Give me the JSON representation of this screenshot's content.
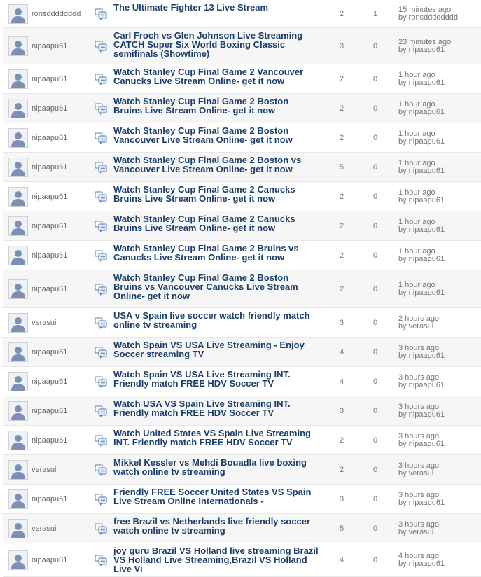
{
  "threads": [
    {
      "author": "ronsdddddddd",
      "title": "The Ultimate Fighter 13 Live Stream",
      "replies": "2",
      "views": "1",
      "last_time": "15 minutes ago",
      "last_by": "by ronsdddddddd"
    },
    {
      "author": "nipaapu61",
      "title": "Carl Froch vs Glen Johnson Live Streaming CATCH Super Six World Boxing Classic semifinals (Showtime)",
      "replies": "3",
      "views": "0",
      "last_time": "23 minutes ago",
      "last_by": "by nipaapu61"
    },
    {
      "author": "nipaapu61",
      "title": "Watch Stanley Cup Final Game 2 Vancouver Canucks Live Stream Online- get it now",
      "replies": "2",
      "views": "0",
      "last_time": "1 hour ago",
      "last_by": "by nipaapu61"
    },
    {
      "author": "nipaapu61",
      "title": "Watch Stanley Cup Final Game 2 Boston Bruins Live Stream Online- get it now",
      "replies": "2",
      "views": "0",
      "last_time": "1 hour ago",
      "last_by": "by nipaapu61"
    },
    {
      "author": "nipaapu61",
      "title": "Watch Stanley Cup Final Game 2 Boston Vancouver Live Stream Online- get it now",
      "replies": "2",
      "views": "0",
      "last_time": "1 hour ago",
      "last_by": "by nipaapu61"
    },
    {
      "author": "nipaapu61",
      "title": "Watch Stanley Cup Final Game 2 Boston vs Vancouver Live Stream Online- get it now",
      "replies": "5",
      "views": "0",
      "last_time": "1 hour ago",
      "last_by": "by nipaapu61"
    },
    {
      "author": "nipaapu61",
      "title": "Watch Stanley Cup Final Game 2 Canucks Bruins Live Stream Online- get it now",
      "replies": "2",
      "views": "0",
      "last_time": "1 hour ago",
      "last_by": "by nipaapu61"
    },
    {
      "author": "nipaapu61",
      "title": "Watch Stanley Cup Final Game 2 Canucks Bruins Live Stream Online- get it now",
      "replies": "2",
      "views": "0",
      "last_time": "1 hour ago",
      "last_by": "by nipaapu61"
    },
    {
      "author": "nipaapu61",
      "title": "Watch Stanley Cup Final Game 2 Bruins vs Canucks Live Stream Online- get it now",
      "replies": "2",
      "views": "0",
      "last_time": "1 hour ago",
      "last_by": "by nipaapu61"
    },
    {
      "author": "nipaapu61",
      "title": "Watch Stanley Cup Final Game 2 Boston Bruins vs Vancouver Canucks Live Stream Online- get it now",
      "replies": "2",
      "views": "0",
      "last_time": "1 hour ago",
      "last_by": "by nipaapu61"
    },
    {
      "author": "verasui",
      "title": "USA v Spain live soccer watch friendly match online tv streaming",
      "replies": "3",
      "views": "0",
      "last_time": "2 hours ago",
      "last_by": "by verasui"
    },
    {
      "author": "nipaapu61",
      "title": "Watch Spain VS USA Live Streaming - Enjoy Soccer streaming TV",
      "replies": "4",
      "views": "0",
      "last_time": "3 hours ago",
      "last_by": "by nipaapu61"
    },
    {
      "author": "nipaapu61",
      "title": "Watch Spain VS USA Live Streaming INT. Friendly match FREE HDV Soccer TV",
      "replies": "4",
      "views": "0",
      "last_time": "3 hours ago",
      "last_by": "by nipaapu61"
    },
    {
      "author": "nipaapu61",
      "title": "Watch USA VS Spain Live Streaming INT. Friendly match FREE HDV Soccer TV",
      "replies": "3",
      "views": "0",
      "last_time": "3 hours ago",
      "last_by": "by nipaapu61"
    },
    {
      "author": "nipaapu61",
      "title": "Watch United States VS Spain Live Streaming INT. Friendly match FREE HDV Soccer TV",
      "replies": "2",
      "views": "0",
      "last_time": "3 hours ago",
      "last_by": "by nipaapu61"
    },
    {
      "author": "verasui",
      "title": "Mikkel Kessler vs Mehdi Bouadla live boxing watch online tv streaming",
      "replies": "2",
      "views": "0",
      "last_time": "3 hours ago",
      "last_by": "by verasui"
    },
    {
      "author": "nipaapu61",
      "title": "Friendly FREE Soccer United States VS Spain Live Stream Online Internationals -",
      "replies": "3",
      "views": "0",
      "last_time": "3 hours ago",
      "last_by": "by nipaapu61"
    },
    {
      "author": "verasui",
      "title": "free Brazil vs Netherlands live friendly soccer watch online tv streaming",
      "replies": "5",
      "views": "0",
      "last_time": "3 hours ago",
      "last_by": "by verasui"
    },
    {
      "author": "nipaapu61",
      "title": "joy guru Brazil VS Holland live streaming Brazil VS Holland Live Streaming,Brazil VS Holland Live Vi",
      "replies": "4",
      "views": "0",
      "last_time": "4 hours ago",
      "last_by": "by nipaapu61"
    }
  ]
}
